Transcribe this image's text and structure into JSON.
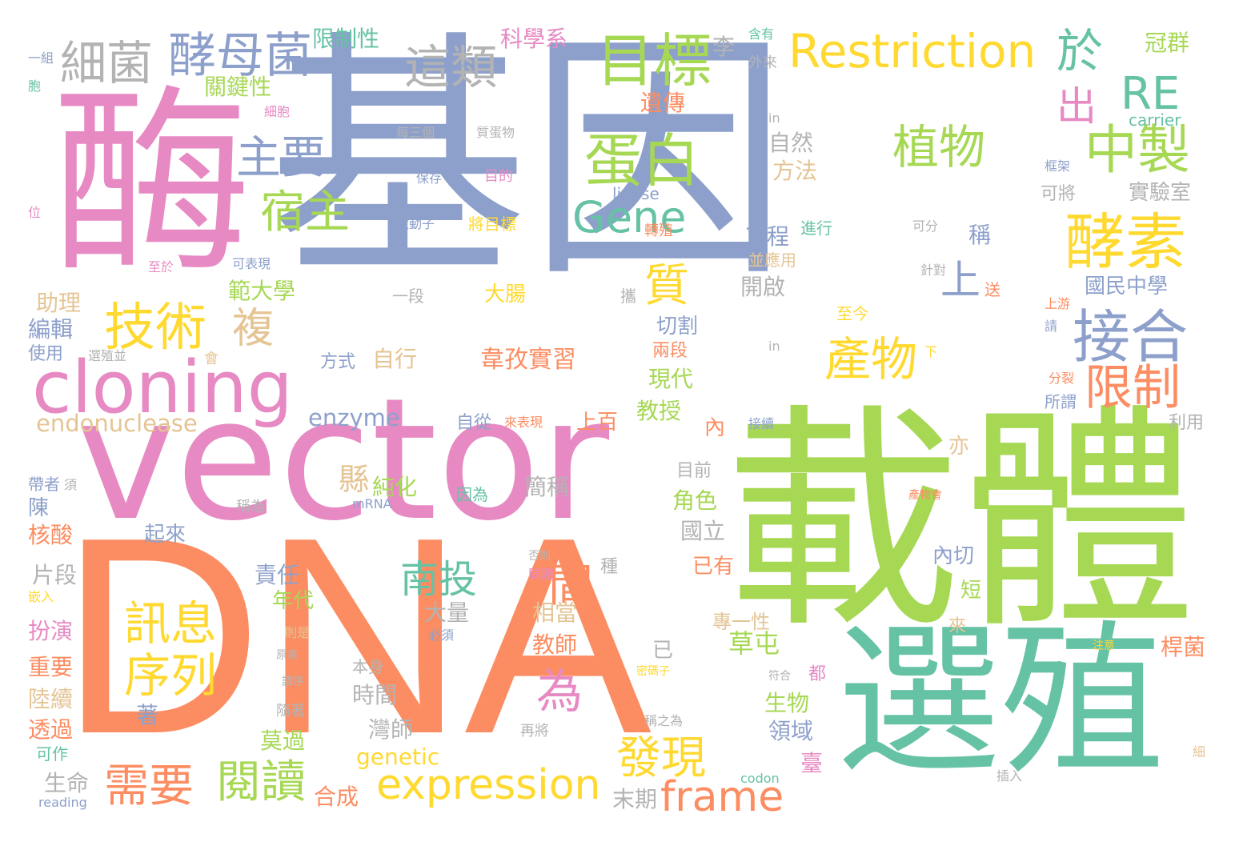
{
  "palette": {
    "blue": "#8da0cb",
    "pink": "#e78ac3",
    "orange": "#fc8d62",
    "green": "#a6d854",
    "teal": "#66c2a5",
    "yellow": "#ffd92f",
    "tan": "#e5c494",
    "gray": "#b3b3b3"
  },
  "words": [
    {
      "text": "基因"
    },
    {
      "text": "載體"
    },
    {
      "text": "DNA"
    },
    {
      "text": "vector"
    },
    {
      "text": "選殖"
    },
    {
      "text": "酶"
    },
    {
      "text": "cloning"
    },
    {
      "text": "技術"
    },
    {
      "text": "目標"
    },
    {
      "text": "蛋白"
    },
    {
      "text": "酵母菌"
    },
    {
      "text": "細菌"
    },
    {
      "text": "主要"
    },
    {
      "text": "宿主"
    },
    {
      "text": "這類"
    },
    {
      "text": "Restriction"
    },
    {
      "text": "RE"
    },
    {
      "text": "於"
    },
    {
      "text": "中製"
    },
    {
      "text": "出"
    },
    {
      "text": "酵素"
    },
    {
      "text": "接合"
    },
    {
      "text": "限制"
    },
    {
      "text": "植物"
    },
    {
      "text": "Gene"
    },
    {
      "text": "產物"
    },
    {
      "text": "上"
    },
    {
      "text": "質"
    },
    {
      "text": "複"
    },
    {
      "text": "expression"
    },
    {
      "text": "frame"
    },
    {
      "text": "需要"
    },
    {
      "text": "閱讀"
    },
    {
      "text": "發現"
    },
    {
      "text": "為"
    },
    {
      "text": "間"
    },
    {
      "text": "南投"
    },
    {
      "text": "訊息"
    },
    {
      "text": "序列"
    },
    {
      "text": "endonuclease"
    },
    {
      "text": "enzyme"
    },
    {
      "text": "genetic"
    },
    {
      "text": "限制性"
    },
    {
      "text": "關鍵性"
    },
    {
      "text": "科學系"
    },
    {
      "text": "李"
    },
    {
      "text": "含有"
    },
    {
      "text": "外來"
    },
    {
      "text": "冠群"
    },
    {
      "text": "一組"
    },
    {
      "text": "胞"
    },
    {
      "text": "細胞"
    },
    {
      "text": "遺傳"
    },
    {
      "text": "in"
    },
    {
      "text": "每三個"
    },
    {
      "text": "質蛋物"
    },
    {
      "text": "carrier"
    },
    {
      "text": "保存"
    },
    {
      "text": "目的"
    },
    {
      "text": "自然"
    },
    {
      "text": "方法"
    },
    {
      "text": "ligase"
    },
    {
      "text": "框架"
    },
    {
      "text": "可將"
    },
    {
      "text": "實驗室"
    },
    {
      "text": "位"
    },
    {
      "text": "啟動子"
    },
    {
      "text": "將目標"
    },
    {
      "text": "工程"
    },
    {
      "text": "進行"
    },
    {
      "text": "可分"
    },
    {
      "text": "稱"
    },
    {
      "text": "轉殖"
    },
    {
      "text": "並應用"
    },
    {
      "text": "針對"
    },
    {
      "text": "至於"
    },
    {
      "text": "可表現"
    },
    {
      "text": "開啟"
    },
    {
      "text": "國民中學"
    },
    {
      "text": "範大學"
    },
    {
      "text": "助理"
    },
    {
      "text": "一段"
    },
    {
      "text": "大腸"
    },
    {
      "text": "攜"
    },
    {
      "text": "送"
    },
    {
      "text": "上游"
    },
    {
      "text": "切割"
    },
    {
      "text": "至今"
    },
    {
      "text": "請"
    },
    {
      "text": "編輯"
    },
    {
      "text": "使用"
    },
    {
      "text": "選殖並"
    },
    {
      "text": "會"
    },
    {
      "text": "方式"
    },
    {
      "text": "自行"
    },
    {
      "text": "韋孜實習"
    },
    {
      "text": "兩段"
    },
    {
      "text": "下"
    },
    {
      "text": "in"
    },
    {
      "text": "現代"
    },
    {
      "text": "教授"
    },
    {
      "text": "分裂"
    },
    {
      "text": "所謂"
    },
    {
      "text": "利用"
    },
    {
      "text": "自從"
    },
    {
      "text": "來表現"
    },
    {
      "text": "上百"
    },
    {
      "text": "接續"
    },
    {
      "text": "內"
    },
    {
      "text": "帶者"
    },
    {
      "text": "須"
    },
    {
      "text": "陳"
    },
    {
      "text": "核酸"
    },
    {
      "text": "縣"
    },
    {
      "text": "純化"
    },
    {
      "text": "簡稱"
    },
    {
      "text": "目前"
    },
    {
      "text": "因為"
    },
    {
      "text": "稱為"
    },
    {
      "text": "mRNA"
    },
    {
      "text": "產物會"
    },
    {
      "text": "亦"
    },
    {
      "text": "角色"
    },
    {
      "text": "起來"
    },
    {
      "text": "國立"
    },
    {
      "text": "否則"
    },
    {
      "text": "問題"
    },
    {
      "text": "種"
    },
    {
      "text": "片段"
    },
    {
      "text": "嵌入"
    },
    {
      "text": "責任"
    },
    {
      "text": "年代"
    },
    {
      "text": "已有"
    },
    {
      "text": "內切"
    },
    {
      "text": "短"
    },
    {
      "text": "大量"
    },
    {
      "text": "相當"
    },
    {
      "text": "扮演"
    },
    {
      "text": "則是"
    },
    {
      "text": "教師"
    },
    {
      "text": "專一性"
    },
    {
      "text": "來"
    },
    {
      "text": "必須"
    },
    {
      "text": "已"
    },
    {
      "text": "草屯"
    },
    {
      "text": "重要"
    },
    {
      "text": "原來"
    },
    {
      "text": "本身"
    },
    {
      "text": "密碼子"
    },
    {
      "text": "注意"
    },
    {
      "text": "桿菌"
    },
    {
      "text": "讀序"
    },
    {
      "text": "陸續"
    },
    {
      "text": "符合"
    },
    {
      "text": "都"
    },
    {
      "text": "時間"
    },
    {
      "text": "生物"
    },
    {
      "text": "隨著"
    },
    {
      "text": "透過"
    },
    {
      "text": "著"
    },
    {
      "text": "灣師"
    },
    {
      "text": "再將"
    },
    {
      "text": "稱之為"
    },
    {
      "text": "領域"
    },
    {
      "text": "莫過"
    },
    {
      "text": "可作"
    },
    {
      "text": "細"
    },
    {
      "text": "臺"
    },
    {
      "text": "生命"
    },
    {
      "text": "codon"
    },
    {
      "text": "插入"
    },
    {
      "text": "合成"
    },
    {
      "text": "末期"
    },
    {
      "text": "reading"
    }
  ]
}
